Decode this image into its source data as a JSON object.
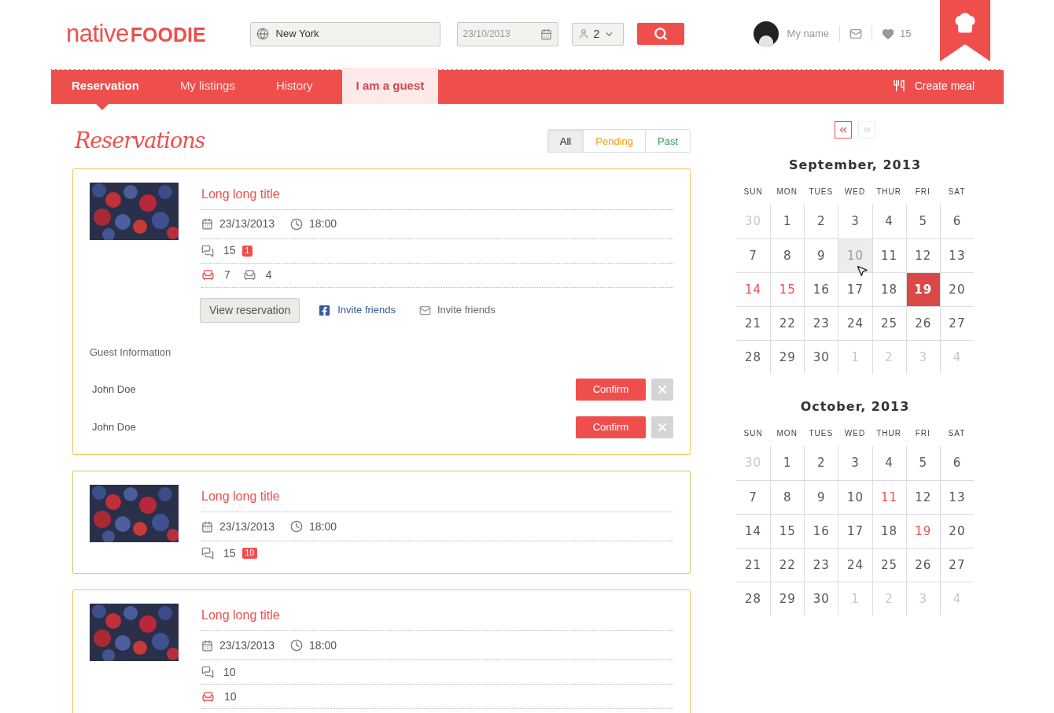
{
  "logo": {
    "light": "native",
    "bold": "FOODIE"
  },
  "search": {
    "location": "New York",
    "date": "23/10/2013",
    "guests": "2"
  },
  "user": {
    "name": "My name",
    "likes": "15"
  },
  "nav": {
    "tabs": [
      {
        "label": "Reservation",
        "selected": true,
        "highlighted": false
      },
      {
        "label": "My listings",
        "selected": false,
        "highlighted": false
      },
      {
        "label": "History",
        "selected": false,
        "highlighted": false
      },
      {
        "label": "I am a guest",
        "selected": false,
        "highlighted": true
      }
    ],
    "action": "Create meal"
  },
  "page_title": "Reservations",
  "filters": [
    {
      "label": "All",
      "selected": true,
      "color": "#222222"
    },
    {
      "label": "Pending",
      "selected": false,
      "color": "#f39c12"
    },
    {
      "label": "Past",
      "selected": false,
      "color": "#2e9e5b"
    }
  ],
  "reservations": [
    {
      "color": "#f7c75e",
      "title": "Long long title",
      "date": "23/13/2013",
      "time": "18:00",
      "comments": "15",
      "new_comments": "1",
      "seats": [
        {
          "count": "7",
          "taken": true
        },
        {
          "count": "4",
          "taken": false
        }
      ],
      "actions": {
        "view": "View reservation",
        "facebook": "Invite friends",
        "email": "Invite friends"
      },
      "guest_heading": "Guest Information",
      "guests": [
        {
          "name": "John Doe",
          "confirm": "Confirm"
        },
        {
          "name": "John Doe",
          "confirm": "Confirm"
        }
      ]
    },
    {
      "color": "#b9d36b",
      "title": "Long long title",
      "date": "23/13/2013",
      "time": "18:00",
      "comments": "15",
      "new_comments": "10"
    },
    {
      "color": "#f7c75e",
      "title": "Long long title",
      "date": "23/13/2013",
      "time": "18:00",
      "comments": "10",
      "seats": [
        {
          "count": "10",
          "taken": true
        }
      ]
    }
  ],
  "calendar": {
    "months": [
      {
        "title": "September, 2013",
        "weekdays": [
          "SUN",
          "MON",
          "TUES",
          "WED",
          "THUR",
          "FRI",
          "SAT"
        ],
        "days": [
          {
            "label": "30",
            "kind": "other"
          },
          {
            "label": "1",
            "kind": "normal"
          },
          {
            "label": "2",
            "kind": "normal"
          },
          {
            "label": "3",
            "kind": "normal"
          },
          {
            "label": "4",
            "kind": "normal"
          },
          {
            "label": "5",
            "kind": "normal"
          },
          {
            "label": "6",
            "kind": "normal"
          },
          {
            "label": "7",
            "kind": "normal"
          },
          {
            "label": "8",
            "kind": "normal"
          },
          {
            "label": "9",
            "kind": "normal"
          },
          {
            "label": "10",
            "kind": "hover"
          },
          {
            "label": "11",
            "kind": "normal"
          },
          {
            "label": "12",
            "kind": "normal"
          },
          {
            "label": "13",
            "kind": "normal"
          },
          {
            "label": "14",
            "kind": "event"
          },
          {
            "label": "15",
            "kind": "event"
          },
          {
            "label": "16",
            "kind": "normal"
          },
          {
            "label": "17",
            "kind": "normal"
          },
          {
            "label": "18",
            "kind": "normal"
          },
          {
            "label": "19",
            "kind": "selected"
          },
          {
            "label": "20",
            "kind": "normal"
          },
          {
            "label": "21",
            "kind": "normal"
          },
          {
            "label": "22",
            "kind": "normal"
          },
          {
            "label": "23",
            "kind": "normal"
          },
          {
            "label": "24",
            "kind": "normal"
          },
          {
            "label": "25",
            "kind": "normal"
          },
          {
            "label": "26",
            "kind": "normal"
          },
          {
            "label": "27",
            "kind": "normal"
          },
          {
            "label": "28",
            "kind": "normal"
          },
          {
            "label": "29",
            "kind": "normal"
          },
          {
            "label": "30",
            "kind": "normal"
          },
          {
            "label": "1",
            "kind": "other"
          },
          {
            "label": "2",
            "kind": "other"
          },
          {
            "label": "3",
            "kind": "other"
          },
          {
            "label": "4",
            "kind": "other"
          }
        ]
      },
      {
        "title": "October, 2013",
        "weekdays": [
          "SUN",
          "MON",
          "TUES",
          "WED",
          "THUR",
          "FRI",
          "SAT"
        ],
        "days": [
          {
            "label": "30",
            "kind": "other"
          },
          {
            "label": "1",
            "kind": "normal"
          },
          {
            "label": "2",
            "kind": "normal"
          },
          {
            "label": "3",
            "kind": "normal"
          },
          {
            "label": "4",
            "kind": "normal"
          },
          {
            "label": "5",
            "kind": "normal"
          },
          {
            "label": "6",
            "kind": "normal"
          },
          {
            "label": "7",
            "kind": "normal"
          },
          {
            "label": "8",
            "kind": "normal"
          },
          {
            "label": "9",
            "kind": "normal"
          },
          {
            "label": "10",
            "kind": "normal"
          },
          {
            "label": "11",
            "kind": "event"
          },
          {
            "label": "12",
            "kind": "normal"
          },
          {
            "label": "13",
            "kind": "normal"
          },
          {
            "label": "14",
            "kind": "normal"
          },
          {
            "label": "15",
            "kind": "normal"
          },
          {
            "label": "16",
            "kind": "normal"
          },
          {
            "label": "17",
            "kind": "normal"
          },
          {
            "label": "18",
            "kind": "normal"
          },
          {
            "label": "19",
            "kind": "event"
          },
          {
            "label": "20",
            "kind": "normal"
          },
          {
            "label": "21",
            "kind": "normal"
          },
          {
            "label": "22",
            "kind": "normal"
          },
          {
            "label": "23",
            "kind": "normal"
          },
          {
            "label": "24",
            "kind": "normal"
          },
          {
            "label": "25",
            "kind": "normal"
          },
          {
            "label": "26",
            "kind": "normal"
          },
          {
            "label": "27",
            "kind": "normal"
          },
          {
            "label": "28",
            "kind": "normal"
          },
          {
            "label": "29",
            "kind": "normal"
          },
          {
            "label": "30",
            "kind": "normal"
          },
          {
            "label": "1",
            "kind": "other"
          },
          {
            "label": "2",
            "kind": "other"
          },
          {
            "label": "3",
            "kind": "other"
          },
          {
            "label": "4",
            "kind": "other"
          }
        ]
      }
    ]
  }
}
